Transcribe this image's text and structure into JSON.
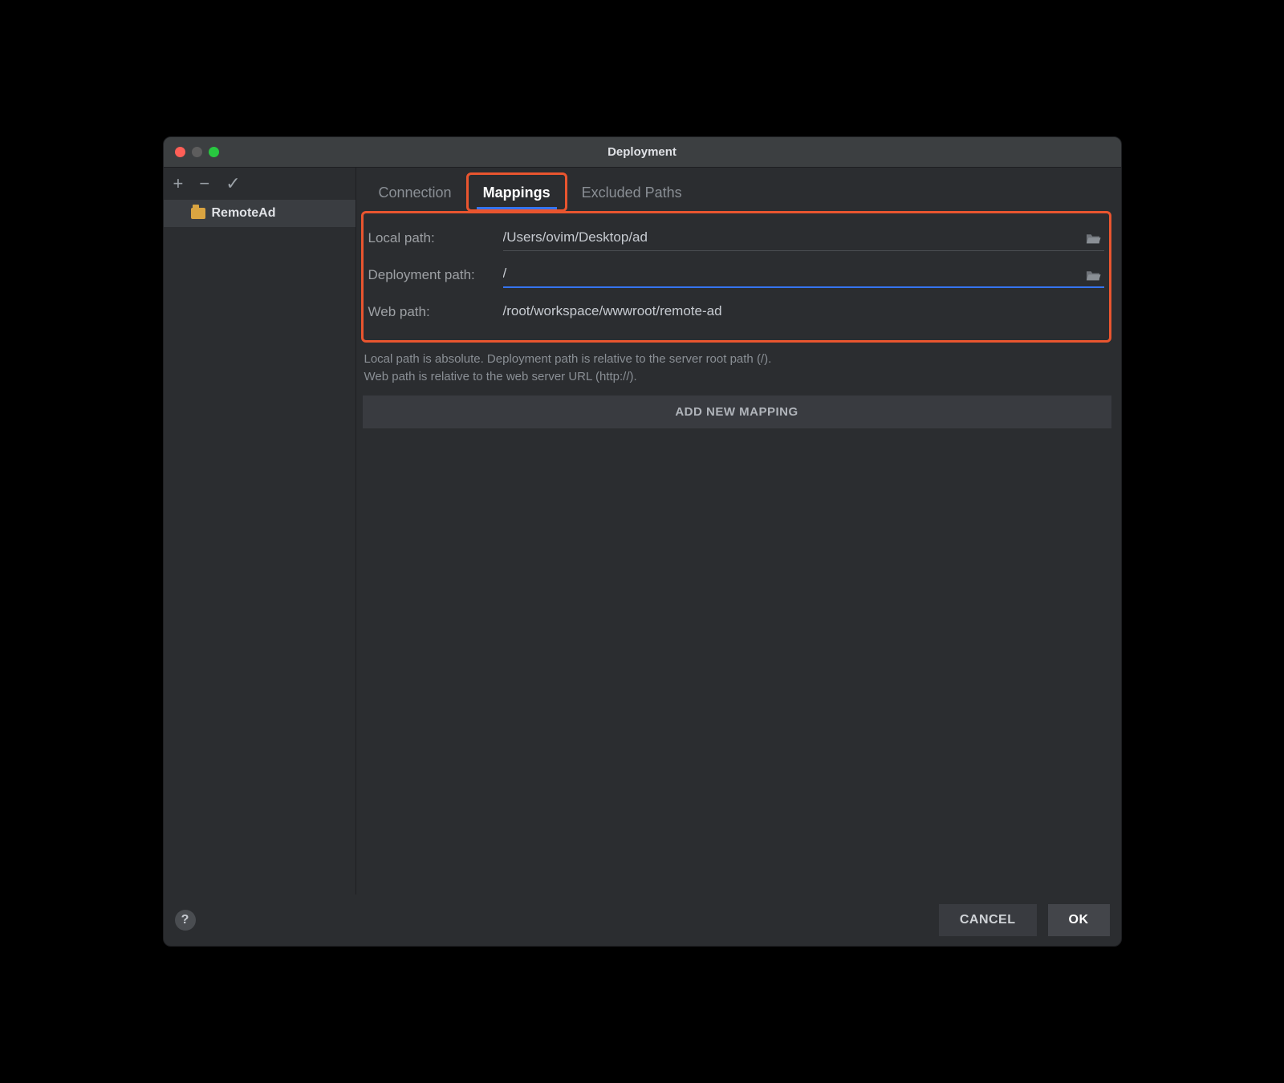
{
  "window": {
    "title": "Deployment"
  },
  "sidebar": {
    "toolbar": {
      "add": "+",
      "remove": "−",
      "apply": "✓"
    },
    "server": {
      "name": "RemoteAd"
    }
  },
  "tabs": {
    "connection": "Connection",
    "mappings": "Mappings",
    "excluded": "Excluded Paths"
  },
  "form": {
    "local_label": "Local path:",
    "local_value": "/Users/ovim/Desktop/ad",
    "deploy_label": "Deployment path:",
    "deploy_value": "/",
    "web_label": "Web path:",
    "web_value": "/root/workspace/wwwroot/remote-ad"
  },
  "help": {
    "line1": "Local path is absolute. Deployment path is relative to the server root path (/).",
    "line2": "Web path is relative to the web server URL (http://)."
  },
  "buttons": {
    "add_mapping": "ADD NEW MAPPING",
    "cancel": "CANCEL",
    "ok": "OK",
    "help": "?"
  },
  "colors": {
    "accent": "#3574f0",
    "highlight": "#e9552f",
    "bg": "#2b2d30"
  }
}
